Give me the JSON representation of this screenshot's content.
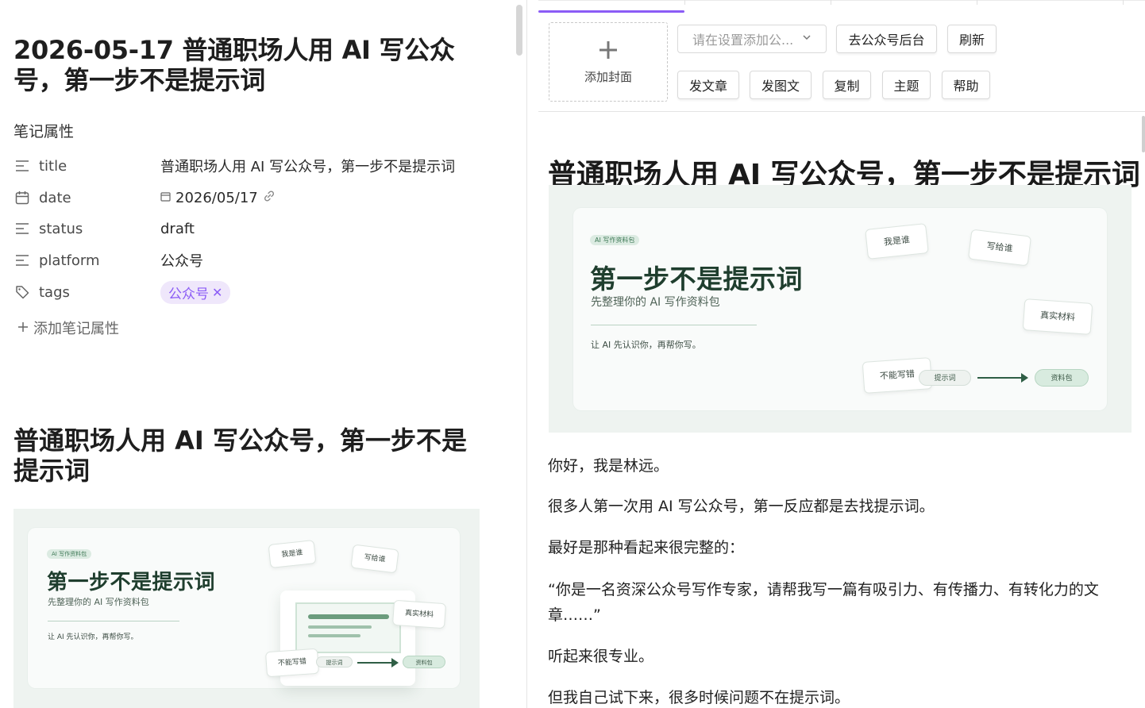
{
  "note": {
    "title": "2026-05-17 普通职场人用 AI 写公众号，第一步不是提示词",
    "properties_heading": "笔记属性",
    "properties": [
      {
        "key": "title",
        "icon": "text-lines-icon",
        "value": "普通职场人用 AI 写公众号，第一步不是提示词"
      },
      {
        "key": "date",
        "icon": "calendar-icon",
        "value": "2026/05/17"
      },
      {
        "key": "status",
        "icon": "text-lines-icon",
        "value": "draft"
      },
      {
        "key": "platform",
        "icon": "text-lines-icon",
        "value": "公众号"
      },
      {
        "key": "tags",
        "icon": "tag-icon",
        "value": "公众号"
      }
    ],
    "add_property_label": "添加笔记属性",
    "body_heading": "普通职场人用 AI 写公众号，第一步不是提示词"
  },
  "cover_graphic": {
    "badge": "AI 写作资料包",
    "title": "第一步不是提示词",
    "subtitle": "先整理你的 AI 写作资料包",
    "note": "让 AI 先认识你，再帮你写。",
    "chips": [
      "我是谁",
      "写给谁",
      "真实材料",
      "不能写错"
    ],
    "pill_left": "提示词",
    "pill_right": "资料包"
  },
  "toolbar": {
    "add_cover_label": "添加封面",
    "account_select_placeholder": "请在设置添加公...",
    "open_backend_label": "去公众号后台",
    "refresh_label": "刷新",
    "publish_article_label": "发文章",
    "publish_image_post_label": "发图文",
    "copy_label": "复制",
    "theme_label": "主题",
    "help_label": "帮助"
  },
  "preview": {
    "title": "普通职场人用 AI 写公众号，第一步不是提示词",
    "paragraphs": [
      "你好，我是林远。",
      "很多人第一次用 AI 写公众号，第一反应都是去找提示词。",
      "最好是那种看起来很完整的：",
      "“你是一名资深公众号写作专家，请帮我写一篇有吸引力、有传播力、有转化力的文章……”",
      "听起来很专业。",
      "但我自己试下来，很多时候问题不在提示词。"
    ]
  },
  "colors": {
    "accent": "#8b5cf6",
    "tag_bg": "#efe7fb",
    "cover_bg": "#eef3f0",
    "cover_title": "#1f3e2e"
  }
}
